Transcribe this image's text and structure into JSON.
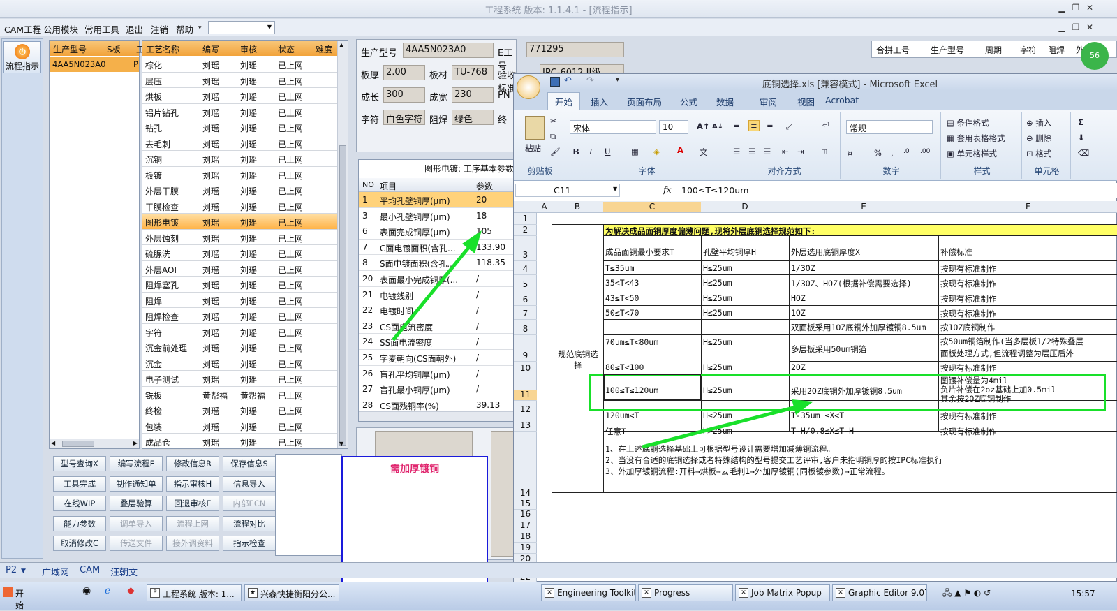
{
  "window": {
    "title": "工程系统  版本: 1.1.4.1 - [流程指示]"
  },
  "menu": {
    "items": [
      "CAM工程",
      "公用模块",
      "常用工具",
      "退出",
      "注销",
      "帮助"
    ],
    "dropdown_arrow": "▾"
  },
  "sidebar": {
    "flow_button": "流程指示"
  },
  "model_table": {
    "headers": [
      "生产型号",
      "S板",
      "工"
    ],
    "rows": [
      [
        "4AA5N023A0",
        "",
        "P"
      ]
    ]
  },
  "process_table": {
    "headers": [
      "工艺名称",
      "编写",
      "审核",
      "状态",
      "难度"
    ],
    "rows": [
      [
        "棕化",
        "刘瑶",
        "刘瑶",
        "已上网"
      ],
      [
        "层压",
        "刘瑶",
        "刘瑶",
        "已上网"
      ],
      [
        "烘板",
        "刘瑶",
        "刘瑶",
        "已上网"
      ],
      [
        "铝片钻孔",
        "刘瑶",
        "刘瑶",
        "已上网"
      ],
      [
        "钻孔",
        "刘瑶",
        "刘瑶",
        "已上网"
      ],
      [
        "去毛刺",
        "刘瑶",
        "刘瑶",
        "已上网"
      ],
      [
        "沉铜",
        "刘瑶",
        "刘瑶",
        "已上网"
      ],
      [
        "板镀",
        "刘瑶",
        "刘瑶",
        "已上网"
      ],
      [
        "外层干膜",
        "刘瑶",
        "刘瑶",
        "已上网"
      ],
      [
        "干膜检查",
        "刘瑶",
        "刘瑶",
        "已上网"
      ],
      [
        "图形电镀",
        "刘瑶",
        "刘瑶",
        "已上网"
      ],
      [
        "外层蚀刻",
        "刘瑶",
        "刘瑶",
        "已上网"
      ],
      [
        "硫脲洗",
        "刘瑶",
        "刘瑶",
        "已上网"
      ],
      [
        "外层AOI",
        "刘瑶",
        "刘瑶",
        "已上网"
      ],
      [
        "阻焊塞孔",
        "刘瑶",
        "刘瑶",
        "已上网"
      ],
      [
        "阻焊",
        "刘瑶",
        "刘瑶",
        "已上网"
      ],
      [
        "阻焊检查",
        "刘瑶",
        "刘瑶",
        "已上网"
      ],
      [
        "字符",
        "刘瑶",
        "刘瑶",
        "已上网"
      ],
      [
        "沉金前处理",
        "刘瑶",
        "刘瑶",
        "已上网"
      ],
      [
        "沉金",
        "刘瑶",
        "刘瑶",
        "已上网"
      ],
      [
        "电子测试",
        "刘瑶",
        "刘瑶",
        "已上网"
      ],
      [
        "铣板",
        "黄帮福",
        "黄帮福",
        "已上网"
      ],
      [
        "终检",
        "刘瑶",
        "刘瑶",
        "已上网"
      ],
      [
        "包装",
        "刘瑶",
        "刘瑶",
        "已上网"
      ],
      [
        "成品仓",
        "刘瑶",
        "刘瑶",
        "已上网"
      ]
    ]
  },
  "buttons": [
    {
      "label": "型号查询X",
      "enabled": true
    },
    {
      "label": "编写流程F",
      "enabled": true
    },
    {
      "label": "修改信息R",
      "enabled": true
    },
    {
      "label": "保存信息S",
      "enabled": true
    },
    {
      "label": "工具完成",
      "enabled": true
    },
    {
      "label": "制作通知单",
      "enabled": true
    },
    {
      "label": "指示审核H",
      "enabled": true
    },
    {
      "label": "信息导入",
      "enabled": true
    },
    {
      "label": "在线WIP",
      "enabled": true
    },
    {
      "label": "叠层验算",
      "enabled": true
    },
    {
      "label": "回退审核E",
      "enabled": true
    },
    {
      "label": "内部ECN",
      "enabled": false
    },
    {
      "label": "能力参数",
      "enabled": true
    },
    {
      "label": "调单导入",
      "enabled": false
    },
    {
      "label": "流程上网",
      "enabled": false
    },
    {
      "label": "流程对比",
      "enabled": true
    },
    {
      "label": "取消修改C",
      "enabled": true
    },
    {
      "label": "传送文件",
      "enabled": false
    },
    {
      "label": "接外调资料",
      "enabled": false
    },
    {
      "label": "指示检查",
      "enabled": true
    }
  ],
  "popup": {
    "text": "需加厚镀铜"
  },
  "info": {
    "model_label": "生产型号",
    "model_value": "4AA5N023A0",
    "eno_label": "E工号",
    "eno_value": "771295",
    "thickness_label": "板厚",
    "thickness_value": "2.00",
    "material_label": "板材",
    "material_value": "TU-768",
    "accept_label": "验收标准",
    "accept_value": "IPC-6012 II级",
    "len_label": "成长",
    "len_value": "300",
    "width_label": "成宽",
    "width_value": "230",
    "pn_label": "PN",
    "char_label": "字符",
    "char_value": "白色字符",
    "mask_label": "阻焊",
    "mask_value": "绿色",
    "end_label": "终"
  },
  "plating": {
    "title": "图形电镀: 工序基本参数",
    "headers": [
      "NO",
      "项目",
      "参数"
    ],
    "rows": [
      [
        "1",
        "平均孔壁铜厚(μm)",
        "20"
      ],
      [
        "3",
        "最小孔壁铜厚(μm)",
        "18"
      ],
      [
        "6",
        "表面完成铜厚(μm)",
        "105"
      ],
      [
        "7",
        "C面电镀面积(含孔...",
        "133.90"
      ],
      [
        "8",
        "S面电镀面积(含孔...",
        "118.35"
      ],
      [
        "20",
        "表面最小完成铜厚(...",
        "/"
      ],
      [
        "21",
        "电镀线别",
        "/"
      ],
      [
        "22",
        "电镀时间",
        "/"
      ],
      [
        "23",
        "CS面电流密度",
        "/"
      ],
      [
        "24",
        "SS面电流密度",
        "/"
      ],
      [
        "25",
        "字麦朝向(CS面朝外)",
        "/"
      ],
      [
        "26",
        "盲孔平均铜厚(μm)",
        "/"
      ],
      [
        "27",
        "盲孔最小铜厚(μm)",
        "/"
      ],
      [
        "28",
        "CS面残铜率(%)",
        "39.13"
      ]
    ]
  },
  "right_header": {
    "cols": [
      "合拼工号",
      "生产型号",
      "周期",
      "字符",
      "阻焊",
      "外层"
    ]
  },
  "badge": "56",
  "excel": {
    "title": "底铜选择.xls  [兼容模式] - Microsoft Excel",
    "tabs": [
      "开始",
      "插入",
      "页面布局",
      "公式",
      "数据",
      "审阅",
      "视图",
      "Acrobat"
    ],
    "groups": [
      "剪贴板",
      "字体",
      "对齐方式",
      "数字",
      "样式",
      "单元格"
    ],
    "paste": "粘贴",
    "font": "宋体",
    "size": "10",
    "numfmt": "常规",
    "styles": [
      "条件格式",
      "套用表格格式",
      "单元格样式"
    ],
    "cellops": [
      "插入",
      "删除",
      "格式"
    ],
    "namebox": "C11",
    "formula": "100≤T≤120um",
    "fx": "fx",
    "cols": [
      "A",
      "B",
      "C",
      "D",
      "E",
      "F"
    ],
    "rows": [
      "1",
      "2",
      "3",
      "4",
      "5",
      "6",
      "7",
      "8",
      "9",
      "10",
      "11",
      "12",
      "13",
      "14",
      "15",
      "16",
      "17",
      "18",
      "19",
      "20",
      "21",
      "22"
    ],
    "header_text": "为解决成品面铜厚度偏薄问题,现将外层底铜选择规范如下:",
    "left_label": "规范底铜选择",
    "col_heads": [
      "成品面铜最小要求T",
      "孔壁平均铜厚H",
      "外层选用底铜厚度X",
      "补偿标准"
    ],
    "r4": [
      "T≤35um",
      "H≤25um",
      "1/3OZ",
      "按现有标准制作"
    ],
    "r5": [
      "35<T<43",
      "H≤25um",
      "1/3OZ、HOZ(根据补偿需要选择)",
      "按现有标准制作"
    ],
    "r6": [
      "43≤T<50",
      "H≤25um",
      "HOZ",
      "按现有标准制作"
    ],
    "r7": [
      "50≤T<70",
      "H≤25um",
      "1OZ",
      "按现有标准制作"
    ],
    "r8a": "双面板采用1OZ底铜外加厚镀铜8.5um",
    "r8d": "按1OZ底铜制作",
    "r89": [
      "70um≤T<80um",
      "H≤25um"
    ],
    "r9a": "多层板采用50um铜箔",
    "r9d1": "按50um铜箔制作(当多层板1/2特殊叠层",
    "r9d2": "面板处理方式,但流程调整为层压后外",
    "r10": [
      "80≤T<100",
      "H≤25um",
      "2OZ",
      "按现有标准制作"
    ],
    "r11": [
      "100≤T≤120um",
      "H≤25um",
      "采用2OZ底铜外加厚镀铜8.5um"
    ],
    "r11d": [
      "图镀补偿量为4mil",
      "负片补偿在2oz基础上加0.5mil",
      "其余按2OZ底铜制作"
    ],
    "r12": [
      "120um<T",
      "H≤25um",
      "T-35um ≤X<T",
      "按现有标准制作"
    ],
    "r13": [
      "任意T",
      "H>25um",
      "T-H/0.8≤X≤T-H",
      "按现有标准制作"
    ],
    "notes": [
      "1、在上述底铜选择基础上可根据型号设计需要增加减薄铜流程。",
      "2、当没有合适的底铜选择或者特殊结构的型号提交工艺评审,客户未指明铜厚的按IPC标准执行",
      "3、外加厚镀铜流程:开料→烘板→去毛刺1→外加厚镀铜(同板镀参数)→正常流程。"
    ]
  },
  "bottom_tabs": [
    "P2",
    "广域网",
    "CAM",
    "汪朝文"
  ],
  "taskbar": {
    "start": "开始",
    "items": [
      "工程系统  版本: 1...",
      "兴森快捷衡阳分公...",
      "Engineering Toolkit 9...",
      "Progress",
      "Job Matrix Popup",
      "Graphic Editor 9.07b..."
    ],
    "clock": "15:57"
  }
}
